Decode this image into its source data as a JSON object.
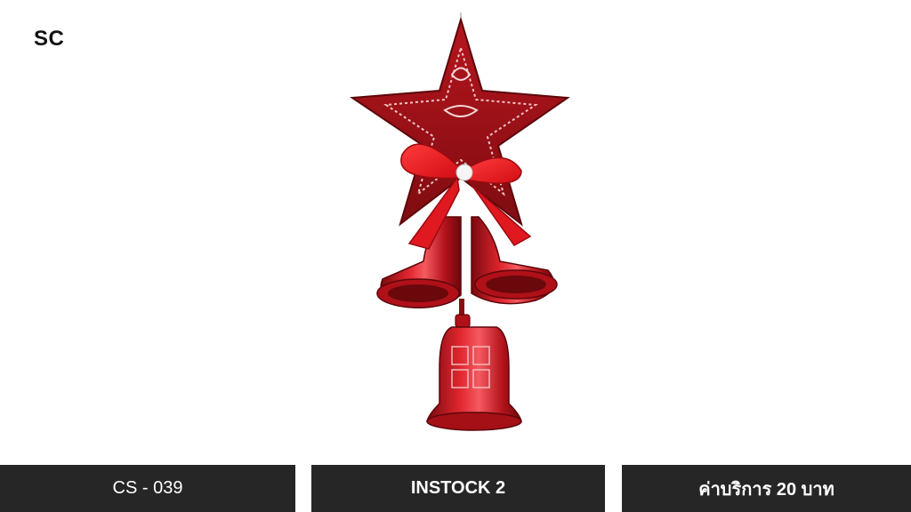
{
  "brand": {
    "logo_text": "SC"
  },
  "product": {
    "image_icon": "star-and-bells-ornament-icon",
    "colors": {
      "primary": "#c0141b",
      "dark": "#6e0a0e",
      "highlight": "#f2545b"
    }
  },
  "footer": {
    "code": "CS - 039",
    "stock": "INSTOCK 2",
    "service_fee": "ค่าบริการ 20 บาท",
    "background": "#262626"
  }
}
